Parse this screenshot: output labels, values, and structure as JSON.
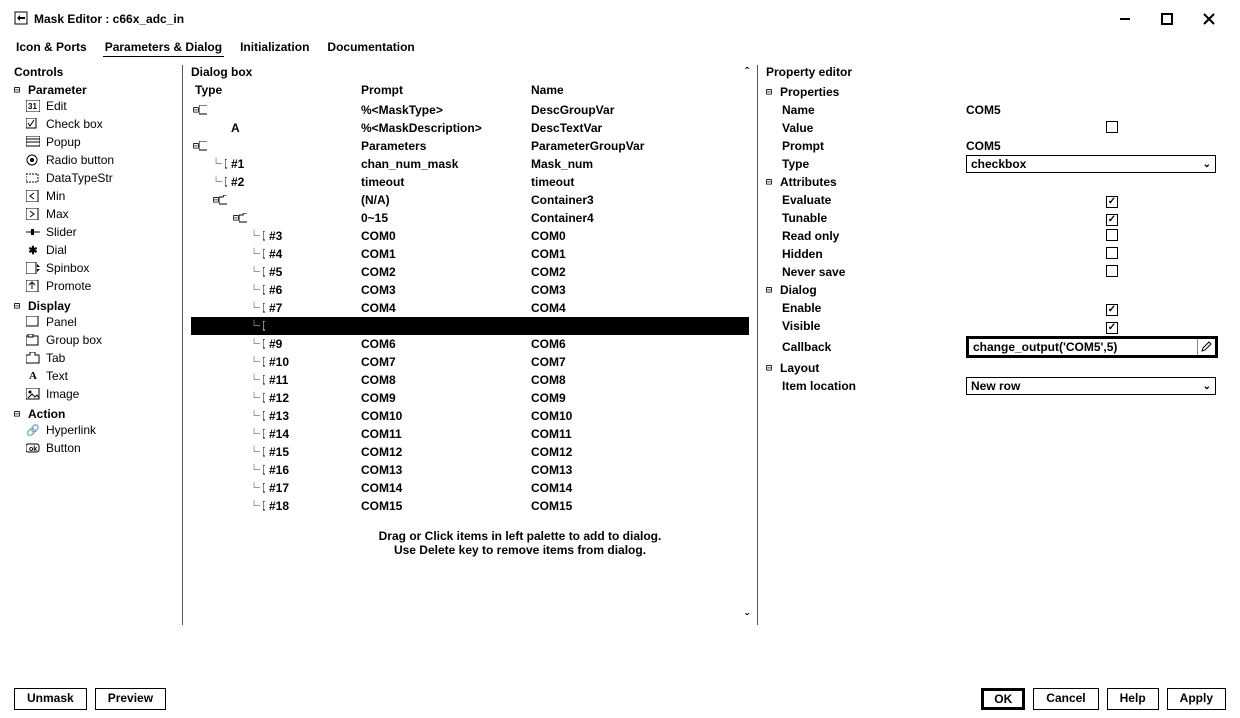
{
  "window": {
    "title": "Mask Editor : c66x_adc_in"
  },
  "menu": {
    "icon_ports": "Icon & Ports",
    "params_dialog": "Parameters & Dialog",
    "initialization": "Initialization",
    "documentation": "Documentation"
  },
  "controls_panel": {
    "title": "Controls",
    "groups": {
      "parameter": "Parameter",
      "display": "Display",
      "action": "Action"
    },
    "parameter_items": {
      "edit": "Edit",
      "checkbox": "Check box",
      "popup": "Popup",
      "radio": "Radio button",
      "datatype": "DataTypeStr",
      "min": "Min",
      "max": "Max",
      "slider": "Slider",
      "dial": "Dial",
      "spinbox": "Spinbox",
      "promote": "Promote"
    },
    "display_items": {
      "panel": "Panel",
      "groupbox": "Group box",
      "tab": "Tab",
      "text": "Text",
      "image": "Image"
    },
    "action_items": {
      "hyperlink": "Hyperlink",
      "button": "Button"
    }
  },
  "dialogbox": {
    "title": "Dialog box",
    "cols": {
      "type": "Type",
      "prompt": "Prompt",
      "name": "Name"
    },
    "rows": [
      {
        "indent": 0,
        "icon": "group",
        "type": "",
        "prompt": "%<MaskType>",
        "name": "DescGroupVar",
        "sel": false
      },
      {
        "indent": 1,
        "icon": "text",
        "type": "A",
        "prompt": "%<MaskDescription>",
        "name": "DescTextVar",
        "sel": false
      },
      {
        "indent": 0,
        "icon": "group",
        "type": "",
        "prompt": "Parameters",
        "name": "ParameterGroupVar",
        "sel": false
      },
      {
        "indent": 1,
        "icon": "edit",
        "type": "#1",
        "prompt": "chan_num_mask",
        "name": "Mask_num",
        "sel": false
      },
      {
        "indent": 1,
        "icon": "edit",
        "type": "#2",
        "prompt": "timeout",
        "name": "timeout",
        "sel": false
      },
      {
        "indent": 1,
        "icon": "folder",
        "type": "",
        "prompt": "(N/A)",
        "name": "Container3",
        "sel": false
      },
      {
        "indent": 2,
        "icon": "folder",
        "type": "",
        "prompt": "0~15",
        "name": "Container4",
        "sel": false
      },
      {
        "indent": 3,
        "icon": "check",
        "type": "#3",
        "prompt": "COM0",
        "name": "COM0",
        "sel": false
      },
      {
        "indent": 3,
        "icon": "check",
        "type": "#4",
        "prompt": "COM1",
        "name": "COM1",
        "sel": false
      },
      {
        "indent": 3,
        "icon": "check",
        "type": "#5",
        "prompt": "COM2",
        "name": "COM2",
        "sel": false
      },
      {
        "indent": 3,
        "icon": "check",
        "type": "#6",
        "prompt": "COM3",
        "name": "COM3",
        "sel": false
      },
      {
        "indent": 3,
        "icon": "check",
        "type": "#7",
        "prompt": "COM4",
        "name": "COM4",
        "sel": false
      },
      {
        "indent": 3,
        "icon": "check",
        "type": "",
        "prompt": "",
        "name": "",
        "sel": true
      },
      {
        "indent": 3,
        "icon": "check",
        "type": "#9",
        "prompt": "COM6",
        "name": "COM6",
        "sel": false
      },
      {
        "indent": 3,
        "icon": "check",
        "type": "#10",
        "prompt": "COM7",
        "name": "COM7",
        "sel": false
      },
      {
        "indent": 3,
        "icon": "check",
        "type": "#11",
        "prompt": "COM8",
        "name": "COM8",
        "sel": false
      },
      {
        "indent": 3,
        "icon": "check",
        "type": "#12",
        "prompt": "COM9",
        "name": "COM9",
        "sel": false
      },
      {
        "indent": 3,
        "icon": "check",
        "type": "#13",
        "prompt": "COM10",
        "name": "COM10",
        "sel": false
      },
      {
        "indent": 3,
        "icon": "check",
        "type": "#14",
        "prompt": "COM11",
        "name": "COM11",
        "sel": false
      },
      {
        "indent": 3,
        "icon": "check",
        "type": "#15",
        "prompt": "COM12",
        "name": "COM12",
        "sel": false
      },
      {
        "indent": 3,
        "icon": "check",
        "type": "#16",
        "prompt": "COM13",
        "name": "COM13",
        "sel": false
      },
      {
        "indent": 3,
        "icon": "check",
        "type": "#17",
        "prompt": "COM14",
        "name": "COM14",
        "sel": false
      },
      {
        "indent": 3,
        "icon": "check",
        "type": "#18",
        "prompt": "COM15",
        "name": "COM15",
        "sel": false
      }
    ],
    "hint1": "Drag or Click items in left palette to add to dialog.",
    "hint2": "Use Delete key to remove items from dialog."
  },
  "prop": {
    "title": "Property editor",
    "sections": {
      "properties": "Properties",
      "attributes": "Attributes",
      "dialog": "Dialog",
      "layout": "Layout"
    },
    "labels": {
      "name": "Name",
      "value": "Value",
      "prompt_lbl": "Prompt",
      "type": "Type",
      "evaluate": "Evaluate",
      "tunable": "Tunable",
      "readonly": "Read only",
      "hidden": "Hidden",
      "neversave": "Never save",
      "enable": "Enable",
      "visible": "Visible",
      "callback": "Callback",
      "itemloc": "Item location"
    },
    "values": {
      "name": "COM5",
      "prompt": "COM5",
      "type": "checkbox",
      "callback": "change_output('COM5',5)",
      "itemloc": "New row"
    },
    "checks": {
      "value": false,
      "evaluate": true,
      "tunable": true,
      "readonly": false,
      "hidden": false,
      "neversave": false,
      "enable": true,
      "visible": true
    }
  },
  "buttons": {
    "unmask": "Unmask",
    "preview": "Preview",
    "ok": "OK",
    "cancel": "Cancel",
    "help": "Help",
    "apply": "Apply"
  }
}
